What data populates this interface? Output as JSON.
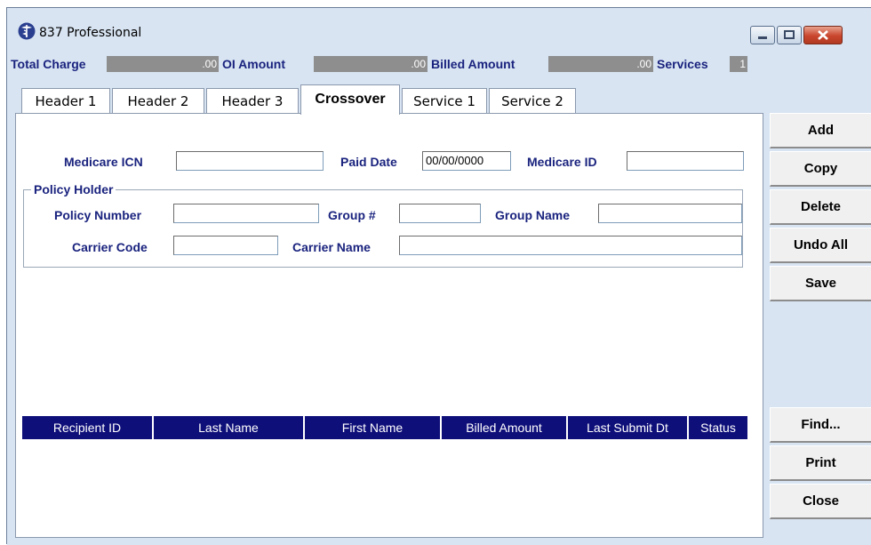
{
  "window": {
    "title": "837 Professional",
    "icon": "caduceus-icon",
    "controls": [
      "minimize-icon",
      "maximize-icon",
      "close-icon"
    ]
  },
  "summary": {
    "total_charge_label": "Total Charge",
    "total_charge_value": ".00",
    "oi_amount_label": "OI Amount",
    "oi_amount_value": ".00",
    "billed_amount_label": "Billed Amount",
    "billed_amount_value": ".00",
    "services_label": "Services",
    "services_value": "1"
  },
  "tabs": [
    {
      "label": "Header 1"
    },
    {
      "label": "Header 2"
    },
    {
      "label": "Header 3"
    },
    {
      "label": "Crossover",
      "active": true
    },
    {
      "label": "Service 1"
    },
    {
      "label": "Service 2"
    }
  ],
  "crossover": {
    "medicare_icn_label": "Medicare ICN",
    "medicare_icn_value": "",
    "paid_date_label": "Paid Date",
    "paid_date_value": "00/00/0000",
    "medicare_id_label": "Medicare ID",
    "medicare_id_value": ""
  },
  "policy_holder": {
    "legend": "Policy Holder",
    "policy_number_label": "Policy Number",
    "policy_number_value": "",
    "group_num_label": "Group #",
    "group_num_value": "",
    "group_name_label": "Group Name",
    "group_name_value": "",
    "carrier_code_label": "Carrier Code",
    "carrier_code_value": "",
    "carrier_name_label": "Carrier Name",
    "carrier_name_value": ""
  },
  "grid": {
    "columns": [
      "Recipient ID",
      "Last Name",
      "First Name",
      "Billed Amount",
      "Last Submit Dt",
      "Status"
    ]
  },
  "buttons": {
    "add": "Add",
    "copy": "Copy",
    "delete": "Delete",
    "undo_all": "Undo All",
    "save": "Save",
    "find": "Find...",
    "print": "Print",
    "close": "Close"
  },
  "colors": {
    "label_text": "#1a237e",
    "grid_header_bg": "#0f0f7a",
    "window_bg": "#d8e4f2",
    "summary_box": "#8e8e8e"
  }
}
